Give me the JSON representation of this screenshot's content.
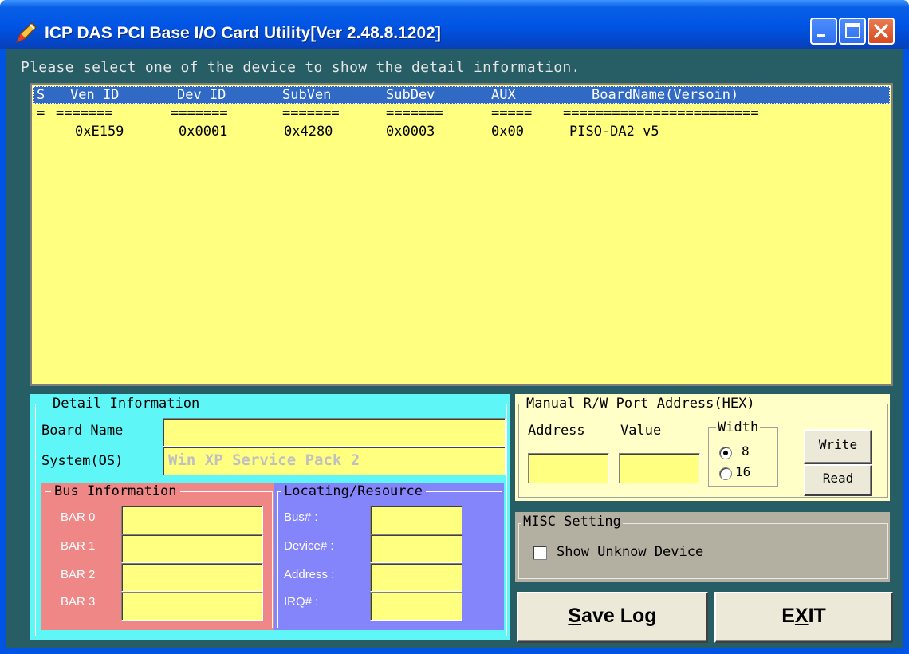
{
  "window": {
    "title": "ICP DAS PCI Base I/O Card Utility[Ver 2.48.8.1202]",
    "accent": "#0054e3",
    "icon": "pen-icon",
    "controls": [
      "minimize-icon",
      "maximize-icon",
      "close-icon"
    ]
  },
  "prompt": "Please select one of the device to show the detail information.",
  "device_list": {
    "columns": [
      "S",
      "Ven ID",
      "Dev ID",
      "SubVen",
      "SubDev",
      "AUX",
      "BoardName(Versoin)"
    ],
    "separators": [
      "=",
      "=======",
      "=======",
      "=======",
      "=======",
      "=====",
      "========================"
    ],
    "rows": [
      {
        "s": "",
        "ven_id": "0xE159",
        "dev_id": "0x0001",
        "subven": "0x4280",
        "subdev": "0x0003",
        "aux": "0x00",
        "board_name": "PISO-DA2 v5"
      }
    ],
    "background": "#ffff80",
    "header_color": "#316ac5"
  },
  "detail": {
    "legend": "Detail Information",
    "board_name_label": "Board Name",
    "board_name_value": "",
    "system_label": "System(OS)",
    "system_value": "Win XP Service Pack 2",
    "bus": {
      "legend": "Bus Information",
      "labels": [
        "BAR 0",
        "BAR 1",
        "BAR 2",
        "BAR 3"
      ]
    },
    "locating": {
      "legend": "Locating/Resource",
      "labels": [
        "Bus# :",
        "Device# :",
        "Address :",
        "IRQ# :"
      ]
    }
  },
  "manual_rw": {
    "legend": "Manual R/W Port Address(HEX)",
    "address_label": "Address",
    "value_label": "Value",
    "width_legend": "Width",
    "width_options": [
      "8",
      "16"
    ],
    "width_selected": "8",
    "write_label": "Write",
    "read_label": "Read"
  },
  "misc": {
    "legend": "MISC Setting",
    "show_unknown_label": "Show Unknow Device",
    "show_unknown_checked": false
  },
  "buttons": {
    "save_log": {
      "mnemonic": "S",
      "rest": "ave Log"
    },
    "exit": {
      "pre": "E",
      "mnemonic": "X",
      "rest": "IT"
    }
  }
}
